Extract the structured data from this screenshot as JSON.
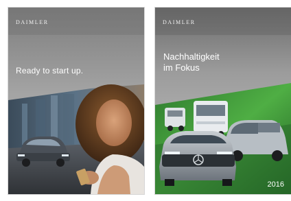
{
  "covers": [
    {
      "brand": "DAIMLER",
      "title": "Ready to start up."
    },
    {
      "brand": "DAIMLER",
      "title_line_1": "Nachhaltigkeit",
      "title_line_2": "im Fokus",
      "year": "2016"
    }
  ],
  "colors": {
    "left_cover_top": "#9a9a9a",
    "right_cover_green": "#3f9a3a",
    "text": "#ffffff"
  }
}
